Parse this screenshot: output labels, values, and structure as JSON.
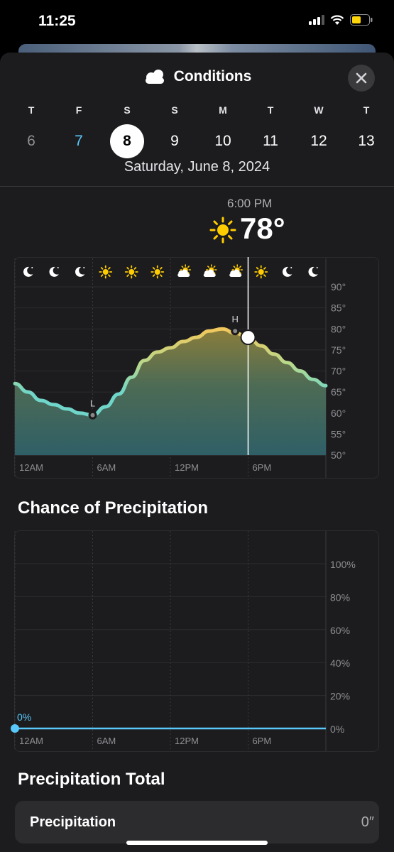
{
  "status_bar": {
    "time": "11:25"
  },
  "header": {
    "title": "Conditions",
    "icon": "cloud-icon"
  },
  "days": [
    {
      "dow": "T",
      "num": "6",
      "state": "past"
    },
    {
      "dow": "F",
      "num": "7",
      "state": "today"
    },
    {
      "dow": "S",
      "num": "8",
      "state": "selected"
    },
    {
      "dow": "S",
      "num": "9",
      "state": "future"
    },
    {
      "dow": "M",
      "num": "10",
      "state": "future"
    },
    {
      "dow": "T",
      "num": "11",
      "state": "future"
    },
    {
      "dow": "W",
      "num": "12",
      "state": "future"
    },
    {
      "dow": "T",
      "num": "13",
      "state": "future"
    }
  ],
  "selected_date": "Saturday, June 8, 2024",
  "selected_point": {
    "time": "6:00 PM",
    "temp": "78°",
    "icon": "sun-icon"
  },
  "temp_chart_data": {
    "type": "area",
    "x_ticks": [
      "12AM",
      "6AM",
      "12PM",
      "6PM"
    ],
    "y_ticks": [
      "90°",
      "85°",
      "80°",
      "75°",
      "70°",
      "65°",
      "60°",
      "55°",
      "50°"
    ],
    "ylim": [
      50,
      90
    ],
    "hours": [
      0,
      1,
      2,
      3,
      4,
      5,
      6,
      7,
      8,
      9,
      10,
      11,
      12,
      13,
      14,
      15,
      16,
      17,
      18,
      19,
      20,
      21,
      22,
      23,
      24
    ],
    "temps": [
      67,
      65,
      63,
      62,
      61,
      60,
      59.5,
      61.5,
      64.5,
      68.5,
      72.5,
      74.5,
      75.5,
      77,
      78,
      79.5,
      80,
      79,
      78,
      76,
      74,
      72,
      70,
      68,
      66.5
    ],
    "low": {
      "hour": 6,
      "value": 59.5,
      "label": "L"
    },
    "high": {
      "hour": 17,
      "value": 79.5,
      "label": "H"
    },
    "selected_hour": 18,
    "condition_icons": [
      "moon-icon",
      "moon-icon",
      "moon-icon",
      "sun-icon",
      "sun-icon",
      "sun-icon",
      "partly-sunny-icon",
      "partly-sunny-icon",
      "partly-sunny-icon",
      "sun-icon",
      "moon-icon",
      "moon-icon"
    ]
  },
  "precip_section_title": "Chance of Precipitation",
  "precip_chart_data": {
    "type": "line",
    "x_ticks": [
      "12AM",
      "6AM",
      "12PM",
      "6PM"
    ],
    "y_ticks": [
      "100%",
      "80%",
      "60%",
      "40%",
      "20%",
      "0%"
    ],
    "ylim": [
      0,
      100
    ],
    "values": [
      0,
      0
    ],
    "current_label": "0%"
  },
  "precip_total": {
    "title": "Precipitation Total",
    "label": "Precipitation",
    "value": "0″"
  },
  "colors": {
    "selected_day_bg": "#ffffff",
    "today": "#5ac8fa",
    "sun": "#ffcc00",
    "precip_line": "#5ac8fa"
  }
}
